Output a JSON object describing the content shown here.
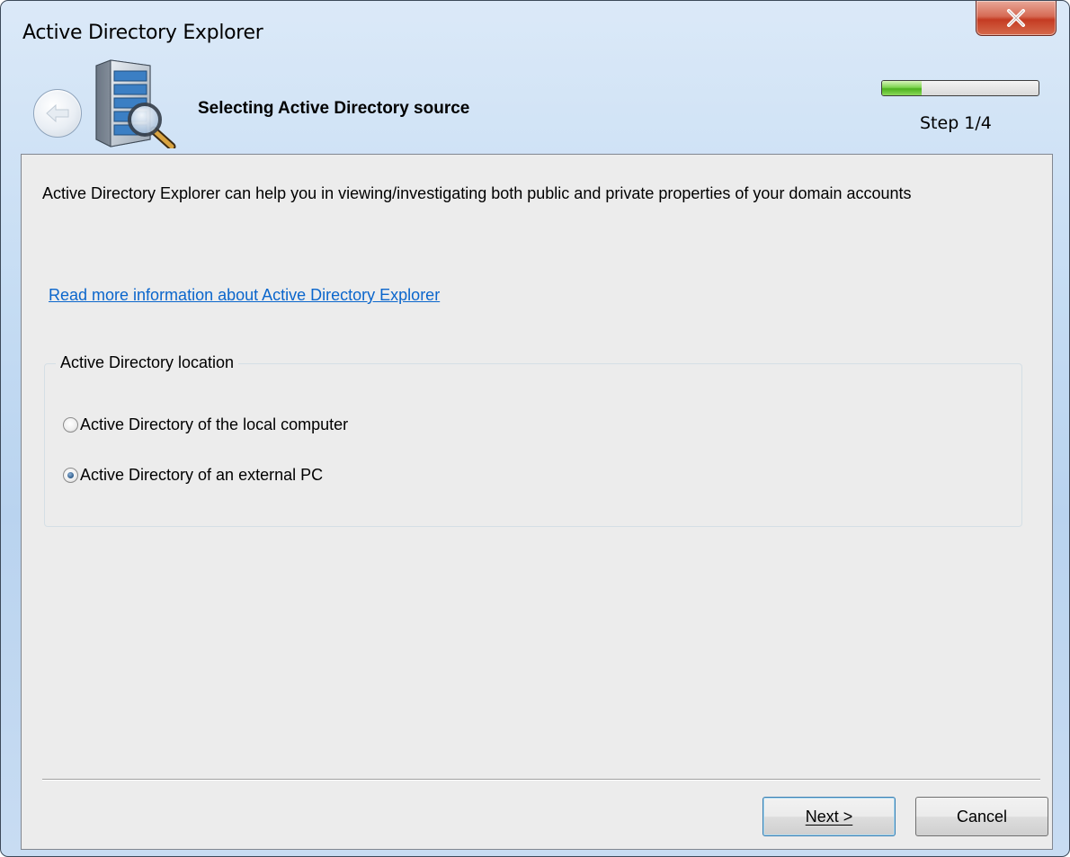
{
  "window": {
    "title": "Active Directory Explorer"
  },
  "header": {
    "title": "Selecting Active Directory source",
    "step_text": "Step 1/4",
    "progress_fraction": 0.25
  },
  "content": {
    "description": "Active Directory Explorer can help you in viewing/investigating both public and private properties of your domain accounts",
    "info_link": "Read more information about Active Directory Explorer",
    "group": {
      "legend": "Active Directory location",
      "options": [
        {
          "label": "Active Directory of the local computer",
          "checked": false
        },
        {
          "label": "Active Directory of an external PC",
          "checked": true
        }
      ]
    }
  },
  "buttons": {
    "next": "Next >",
    "cancel": "Cancel"
  },
  "icons": {
    "close": "close-icon",
    "back": "back-arrow-icon",
    "server": "server-search-icon"
  },
  "colors": {
    "link": "#0b66cc",
    "close_red": "#c43b22",
    "progress_green": "#4db21e"
  }
}
